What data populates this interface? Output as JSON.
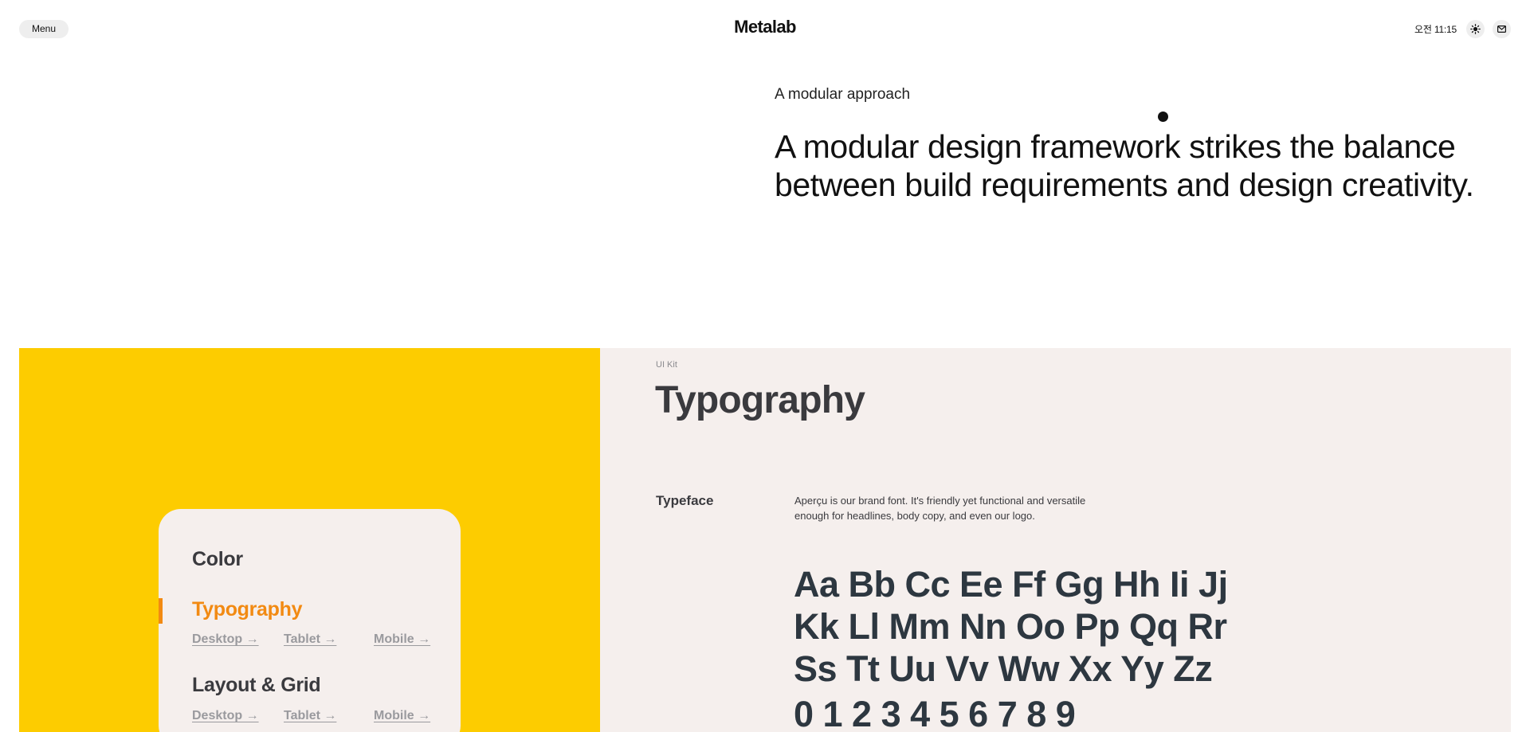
{
  "header": {
    "menu_label": "Menu",
    "logo": "Metalab",
    "time": "오전 11:15",
    "theme_icon": "sun-icon",
    "contact_icon": "mail-icon"
  },
  "intro": {
    "eyebrow": "A modular approach",
    "headline": "A modular design framework strikes the balance between build requirements and design creativity."
  },
  "nav_card": {
    "color": "Color",
    "typography": "Typography",
    "typography_links": [
      "Desktop →",
      "Tablet →",
      "Mobile →"
    ],
    "layout": "Layout & Grid",
    "layout_links": [
      "Desktop →",
      "Tablet →",
      "Mobile →"
    ]
  },
  "ui_kit": {
    "crumb": "UI Kit",
    "title": "Typography",
    "typeface_label": "Typeface",
    "typeface_description": "Aperçu is our brand font. It's friendly yet functional and versatile enough for headlines, body copy, and even our logo.",
    "specimen": [
      "Aa Bb Cc Ee Ff Gg Hh Ii Jj",
      "Kk Ll Mm Nn Oo Pp Qq Rr",
      "Ss Tt Uu Vv Ww Xx Yy Zz",
      "0 1 2 3 4 5 6 7 8 9"
    ]
  },
  "colors": {
    "yellow": "#fdcc00",
    "beige": "#f5efed",
    "accent_orange": "#f28a12",
    "heading_gray": "#3a3a3e",
    "specimen_slate": "#2d3740"
  }
}
